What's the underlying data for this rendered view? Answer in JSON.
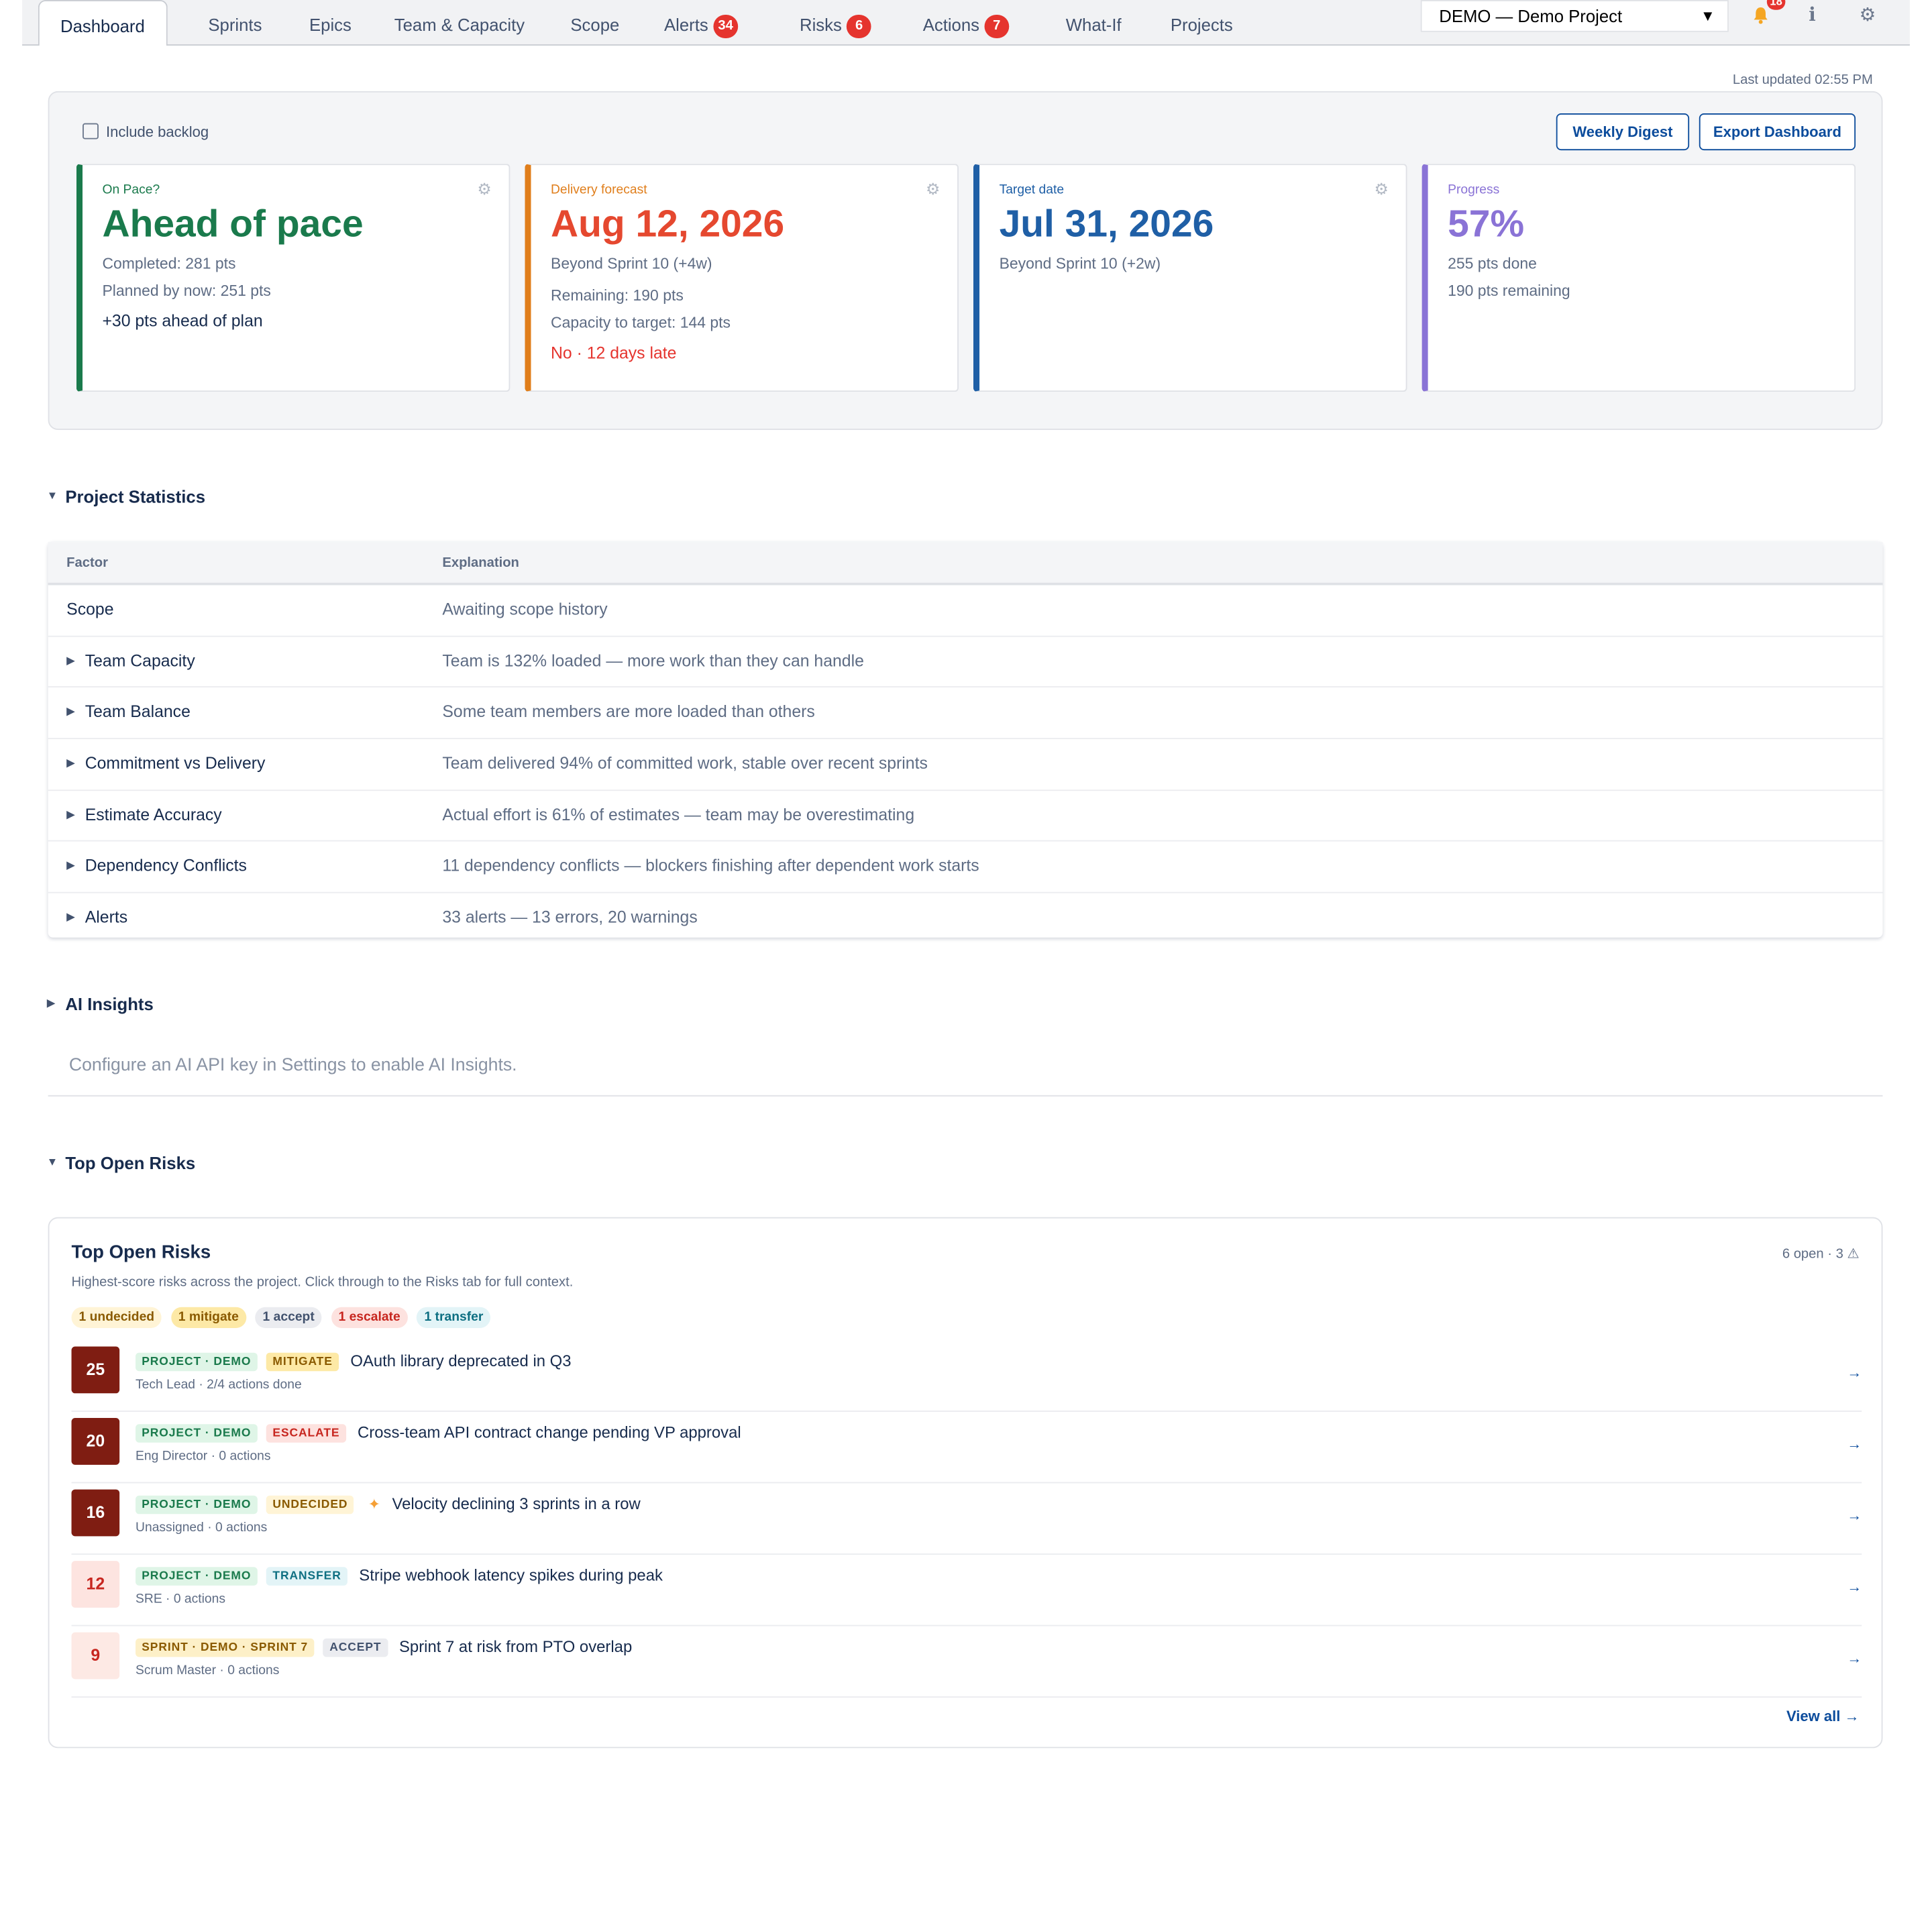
{
  "nav": {
    "tabs": [
      {
        "label": "Dashboard"
      },
      {
        "label": "Sprints"
      },
      {
        "label": "Epics"
      },
      {
        "label": "Team & Capacity"
      },
      {
        "label": "Scope"
      },
      {
        "label": "Alerts",
        "badge": "34"
      },
      {
        "label": "Risks",
        "badge": "6"
      },
      {
        "label": "Actions",
        "badge": "7"
      },
      {
        "label": "What-If"
      },
      {
        "label": "Projects"
      }
    ],
    "project_select": "DEMO — Demo Project",
    "notification_count": "18",
    "icons": [
      "bell-icon",
      "info-icon",
      "gear-icon"
    ]
  },
  "last_updated": "Last updated 02:55 PM",
  "summary": {
    "include_backlog": "Include backlog",
    "weekly_digest": "Weekly Digest",
    "export": "Export Dashboard",
    "cards": {
      "pace": {
        "label": "On Pace?",
        "value": "Ahead of pace",
        "line1": "Completed: 281 pts",
        "line2": "Planned by now: 251 pts",
        "emph": "+30 pts ahead of plan",
        "color": "#1a7a4c"
      },
      "forecast": {
        "label": "Delivery forecast",
        "value": "Aug 12, 2026",
        "line1": "Beyond Sprint 10 (+4w)",
        "line2": "Remaining: 190 pts",
        "line3": "Capacity to target: 144 pts",
        "emph": "No · 12 days late",
        "color": "#e5482f",
        "accent": "#e07e1b"
      },
      "target": {
        "label": "Target date",
        "value": "Jul 31, 2026",
        "line1": "Beyond Sprint 10 (+2w)",
        "color": "#1f5fa6"
      },
      "progress": {
        "label": "Progress",
        "value": "57%",
        "line1": "255 pts done",
        "line2": "190 pts remaining",
        "color": "#8a73d6"
      }
    }
  },
  "stats": {
    "heading": "Project Statistics",
    "col_factor": "Factor",
    "col_explanation": "Explanation",
    "rows": [
      {
        "factor": "Scope",
        "explanation": "Awaiting scope history"
      },
      {
        "factor": "Team Capacity",
        "explanation": "Team is 132% loaded — more work than they can handle"
      },
      {
        "factor": "Team Balance",
        "explanation": "Some team members are more loaded than others"
      },
      {
        "factor": "Commitment vs Delivery",
        "explanation": "Team delivered 94% of committed work, stable over recent sprints"
      },
      {
        "factor": "Estimate Accuracy",
        "explanation": "Actual effort is 61% of estimates — team may be overestimating"
      },
      {
        "factor": "Dependency Conflicts",
        "explanation": "11 dependency conflicts — blockers finishing after dependent work starts"
      },
      {
        "factor": "Alerts",
        "explanation": "33 alerts — 13 errors, 20 warnings"
      }
    ]
  },
  "ai": {
    "heading": "AI Insights",
    "message": "Configure an AI API key in Settings to enable AI Insights."
  },
  "risks": {
    "heading": "Top Open Risks",
    "title": "Top Open Risks",
    "subtitle": "Highest-score risks across the project. Click through to the Risks tab for full context.",
    "open_count": "6 open · 3 ⚠",
    "pills": [
      "1 undecided",
      "1 mitigate",
      "1 accept",
      "1 escalate",
      "1 transfer"
    ],
    "items": [
      {
        "score": "25",
        "scope": "PROJECT · DEMO",
        "decision": "MITIGATE",
        "title": "OAuth library deprecated in Q3",
        "meta": "Tech Lead · 2/4 actions done"
      },
      {
        "score": "20",
        "scope": "PROJECT · DEMO",
        "decision": "ESCALATE",
        "title": "Cross-team API contract change pending VP approval",
        "meta": "Eng Director · 0 actions"
      },
      {
        "score": "16",
        "scope": "PROJECT · DEMO",
        "decision": "UNDECIDED",
        "title": "Velocity declining 3 sprints in a row",
        "meta": "Unassigned · 0 actions"
      },
      {
        "score": "12",
        "scope": "PROJECT · DEMO",
        "decision": "TRANSFER",
        "title": "Stripe webhook latency spikes during peak",
        "meta": "SRE · 0 actions"
      },
      {
        "score": "9",
        "scope": "SPRINT · DEMO · SPRINT 7",
        "decision": "ACCEPT",
        "title": "Sprint 7 at risk from PTO overlap",
        "meta": "Scrum Master · 0 actions"
      }
    ],
    "arrow": "→",
    "view_all": "View all →"
  }
}
